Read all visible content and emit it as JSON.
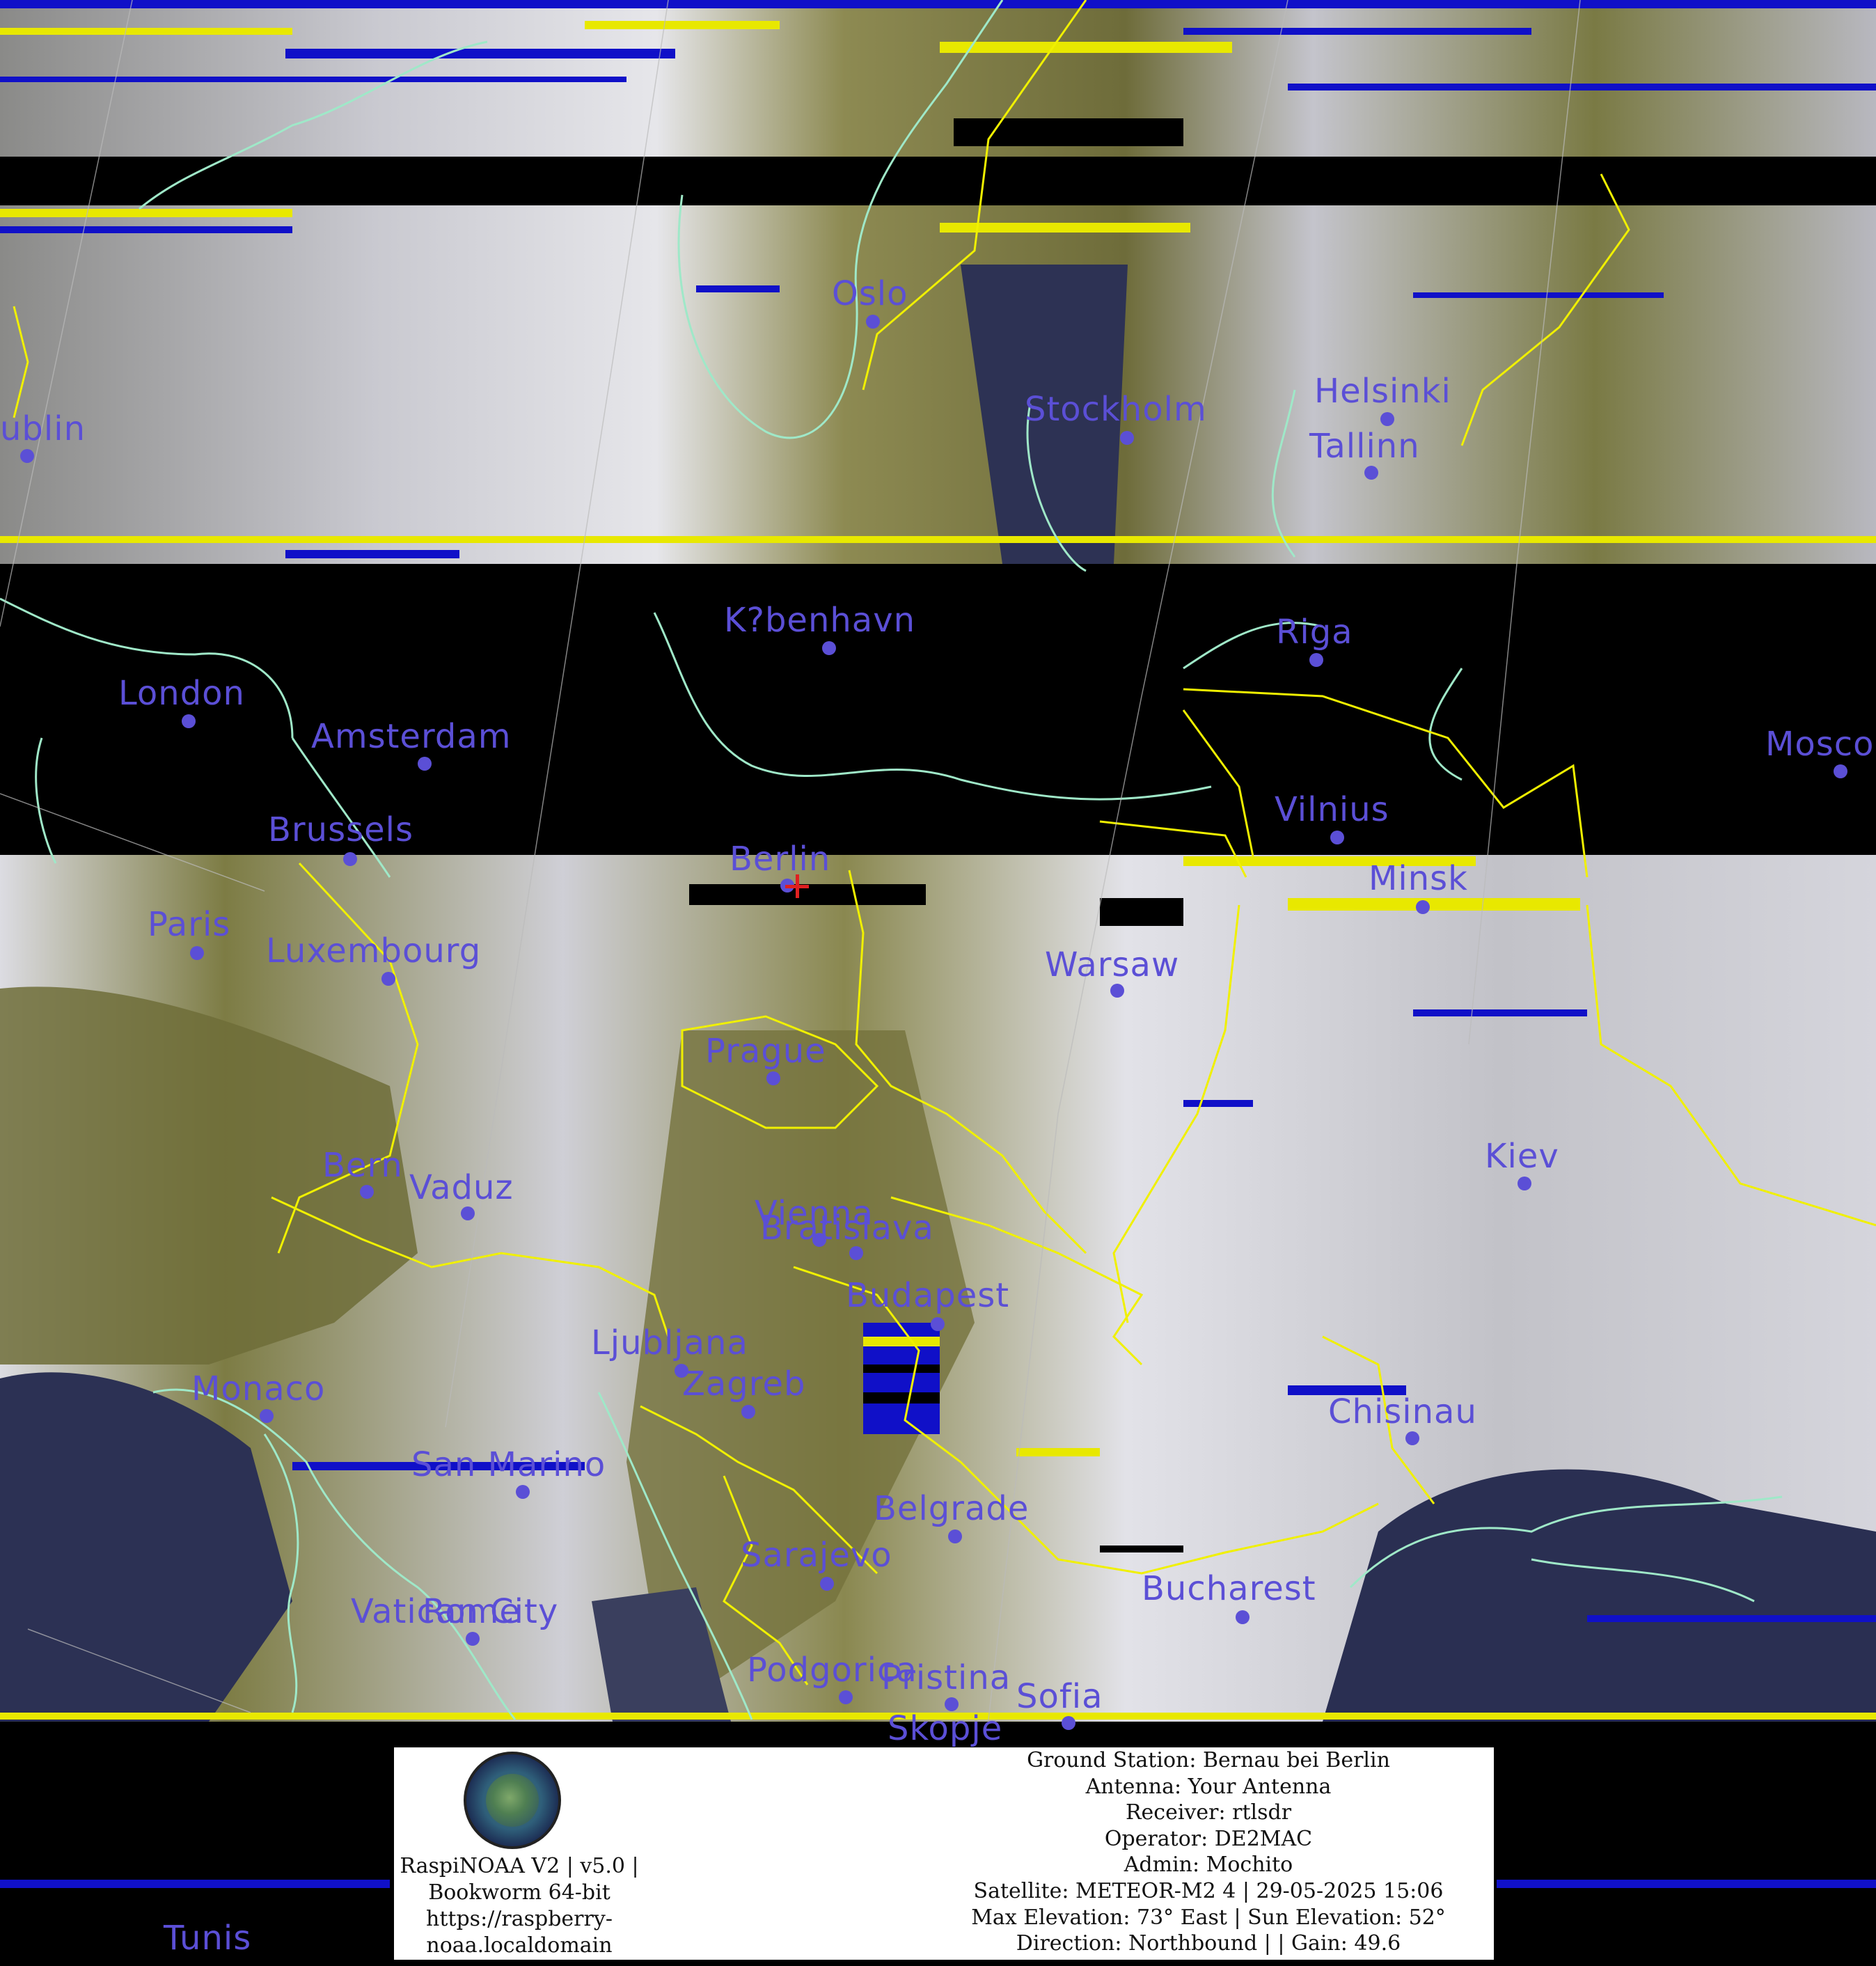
{
  "map": {
    "colors": {
      "land": "#7a7a3a",
      "cloud": "#d9d9e0",
      "sea": "#2a2f52",
      "coastline": "#9fe8c8",
      "borders": "#f0f000",
      "city_text": "#5b4fd6",
      "station_marker": "#e02020",
      "noise_blue": "#1010c8",
      "noise_yellow": "#e8e800"
    },
    "ground_station_marker": "red-cross-icon",
    "cities": [
      {
        "name": "ublin"
      },
      {
        "name": "Oslo"
      },
      {
        "name": "Stockholm"
      },
      {
        "name": "Helsinki"
      },
      {
        "name": "Tallinn"
      },
      {
        "name": "K?benhavn"
      },
      {
        "name": "Riga"
      },
      {
        "name": "London"
      },
      {
        "name": "Amsterdam"
      },
      {
        "name": "Mosco"
      },
      {
        "name": "Vilnius"
      },
      {
        "name": "Brussels"
      },
      {
        "name": "Berlin"
      },
      {
        "name": "Minsk"
      },
      {
        "name": "Paris"
      },
      {
        "name": "Luxembourg"
      },
      {
        "name": "Warsaw"
      },
      {
        "name": "Prague"
      },
      {
        "name": "Bern"
      },
      {
        "name": "Vaduz"
      },
      {
        "name": "Kiev"
      },
      {
        "name": "Vienna"
      },
      {
        "name": "Bratislava"
      },
      {
        "name": "Budapest"
      },
      {
        "name": "Ljubljana"
      },
      {
        "name": "Zagreb"
      },
      {
        "name": "Monaco"
      },
      {
        "name": "Chisinau"
      },
      {
        "name": "San Marino"
      },
      {
        "name": "Belgrade"
      },
      {
        "name": "Sarajevo"
      },
      {
        "name": "Bucharest"
      },
      {
        "name": "Vatican City"
      },
      {
        "name": "Rome"
      },
      {
        "name": "Podgorica"
      },
      {
        "name": "Pristina"
      },
      {
        "name": "Sofia"
      },
      {
        "name": "Skopje"
      },
      {
        "name": "Tunis"
      }
    ]
  },
  "info_box": {
    "logo": "raspinoaa-logo-icon",
    "software_lines": [
      "RaspiNOAA V2 | v5.0 |",
      "Bookworm 64-bit",
      "https://raspberry-",
      "noaa.localdomain"
    ],
    "station_lines": [
      "Ground Station: Bernau bei Berlin",
      "Antenna: Your Antenna",
      "Receiver: rtlsdr",
      "Operator: DE2MAC",
      "Admin: Mochito",
      "Satellite: METEOR-M2 4 | 29-05-2025 15:06",
      "Max Elevation: 73° East | Sun Elevation: 52°",
      "Direction: Northbound | | Gain: 49.6"
    ]
  }
}
